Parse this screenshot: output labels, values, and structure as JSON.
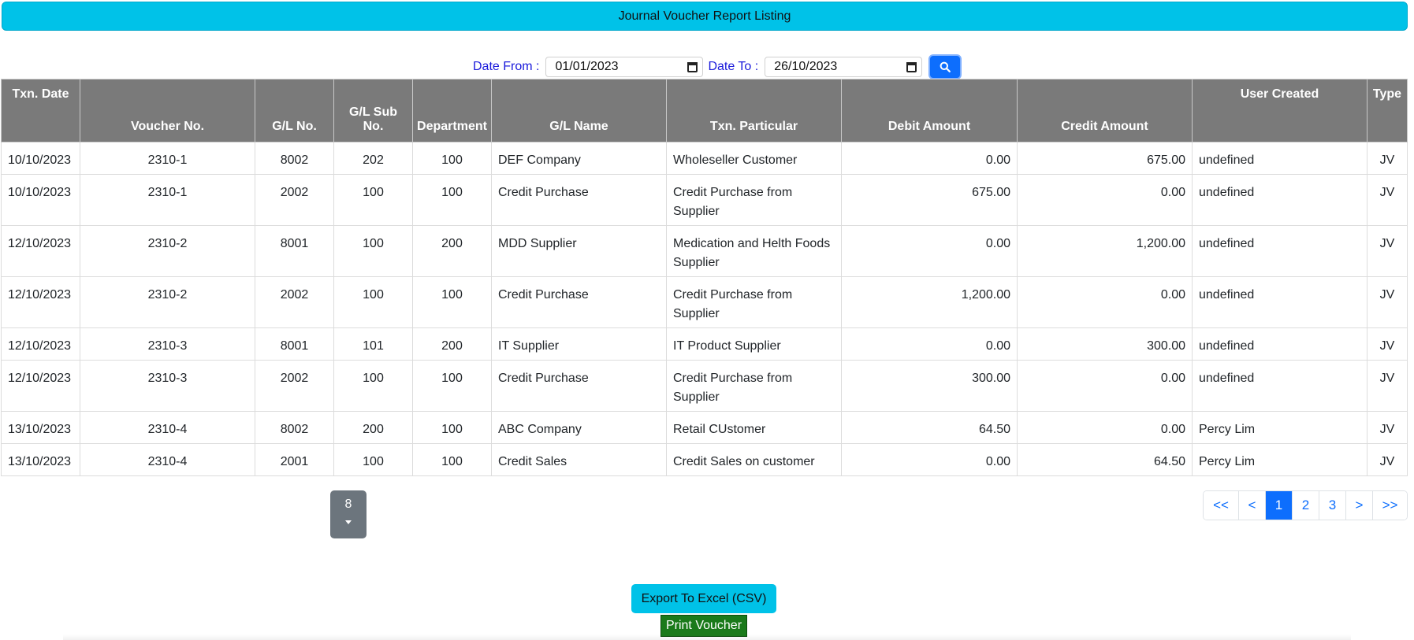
{
  "header": {
    "title": "Journal Voucher Report Listing"
  },
  "filters": {
    "date_from_label": "Date From :",
    "date_from_value": "01/01/2023",
    "date_to_label": "Date To :",
    "date_to_value": "26/10/2023"
  },
  "table": {
    "columns": {
      "txn_date": "Txn. Date",
      "voucher_no": "Voucher No.",
      "gl_no": "G/L No.",
      "gl_sub_no": "G/L Sub No.",
      "department": "Department",
      "gl_name": "G/L Name",
      "txn_particular": "Txn. Particular",
      "debit_amount": "Debit Amount",
      "credit_amount": "Credit Amount",
      "user_created": "User Created",
      "type": "Type"
    },
    "rows": [
      [
        "10/10/2023",
        "2310-1",
        "8002",
        "202",
        "100",
        "DEF Company",
        "Wholeseller Customer",
        "0.00",
        "675.00",
        "undefined",
        "JV"
      ],
      [
        "10/10/2023",
        "2310-1",
        "2002",
        "100",
        "100",
        "Credit Purchase",
        "Credit Purchase from Supplier",
        "675.00",
        "0.00",
        "undefined",
        "JV"
      ],
      [
        "12/10/2023",
        "2310-2",
        "8001",
        "100",
        "200",
        "MDD Supplier",
        "Medication and Helth Foods Supplier",
        "0.00",
        "1,200.00",
        "undefined",
        "JV"
      ],
      [
        "12/10/2023",
        "2310-2",
        "2002",
        "100",
        "100",
        "Credit Purchase",
        "Credit Purchase from Supplier",
        "1,200.00",
        "0.00",
        "undefined",
        "JV"
      ],
      [
        "12/10/2023",
        "2310-3",
        "8001",
        "101",
        "200",
        "IT Supplier",
        "IT Product Supplier",
        "0.00",
        "300.00",
        "undefined",
        "JV"
      ],
      [
        "12/10/2023",
        "2310-3",
        "2002",
        "100",
        "100",
        "Credit Purchase",
        "Credit Purchase from Supplier",
        "300.00",
        "0.00",
        "undefined",
        "JV"
      ],
      [
        "13/10/2023",
        "2310-4",
        "8002",
        "200",
        "100",
        "ABC Company",
        "Retail CUstomer",
        "64.50",
        "0.00",
        "Percy Lim",
        "JV"
      ],
      [
        "13/10/2023",
        "2310-4",
        "2001",
        "100",
        "100",
        "Credit Sales",
        "Credit Sales on customer",
        "0.00",
        "64.50",
        "Percy Lim",
        "JV"
      ]
    ]
  },
  "page_size": {
    "value": "8"
  },
  "pagination": {
    "first": "<<",
    "prev": "<",
    "pages": [
      "1",
      "2",
      "3"
    ],
    "active_page": "1",
    "next": ">",
    "last": ">>"
  },
  "actions": {
    "export_label": "Export To Excel (CSV)",
    "print_label": "Print Voucher"
  },
  "colors": {
    "title_bar": "#00c2e8",
    "table_header": "#7a7a7a",
    "primary": "#0d6efd",
    "print_button": "#1a7a1a",
    "page_size_button": "#6c757d"
  }
}
